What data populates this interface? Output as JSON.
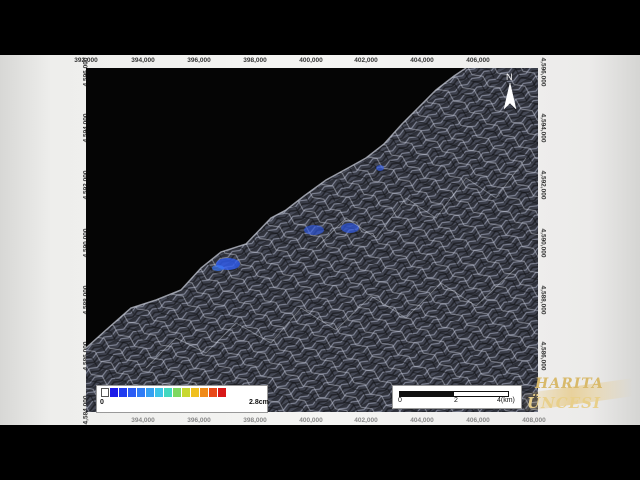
{
  "map": {
    "easting_ticks": [
      "392,000",
      "394,000",
      "396,000",
      "398,000",
      "400,000",
      "402,000",
      "404,000",
      "406,000",
      "408,000"
    ],
    "northing_ticks": [
      "4,596,000",
      "4,594,000",
      "4,592,000",
      "4,590,000",
      "4,588,000",
      "4,586,000",
      "4,584,000"
    ],
    "north_label": "N",
    "legend": {
      "min_label": "0",
      "max_label": "2.8cm",
      "colors": [
        "#ffffff",
        "#1b1be8",
        "#1f3cf0",
        "#2a5cf5",
        "#2f7cf6",
        "#35a0f2",
        "#3cc4e8",
        "#42d8c0",
        "#7ed860",
        "#c8d830",
        "#f0c020",
        "#f08a18",
        "#e84818",
        "#d81818"
      ]
    },
    "scale_bar": {
      "labels": [
        "0",
        "2",
        "4(km)"
      ]
    }
  },
  "logo": {
    "line1": "HARITA",
    "line2": "ÜNCESI"
  },
  "colors": {
    "background": "#000000",
    "screen": "#f1f1ef",
    "map_frame": "#060606",
    "terrain_highlight": "#b8bccc",
    "deformation_blue": "#2f5cf0"
  }
}
